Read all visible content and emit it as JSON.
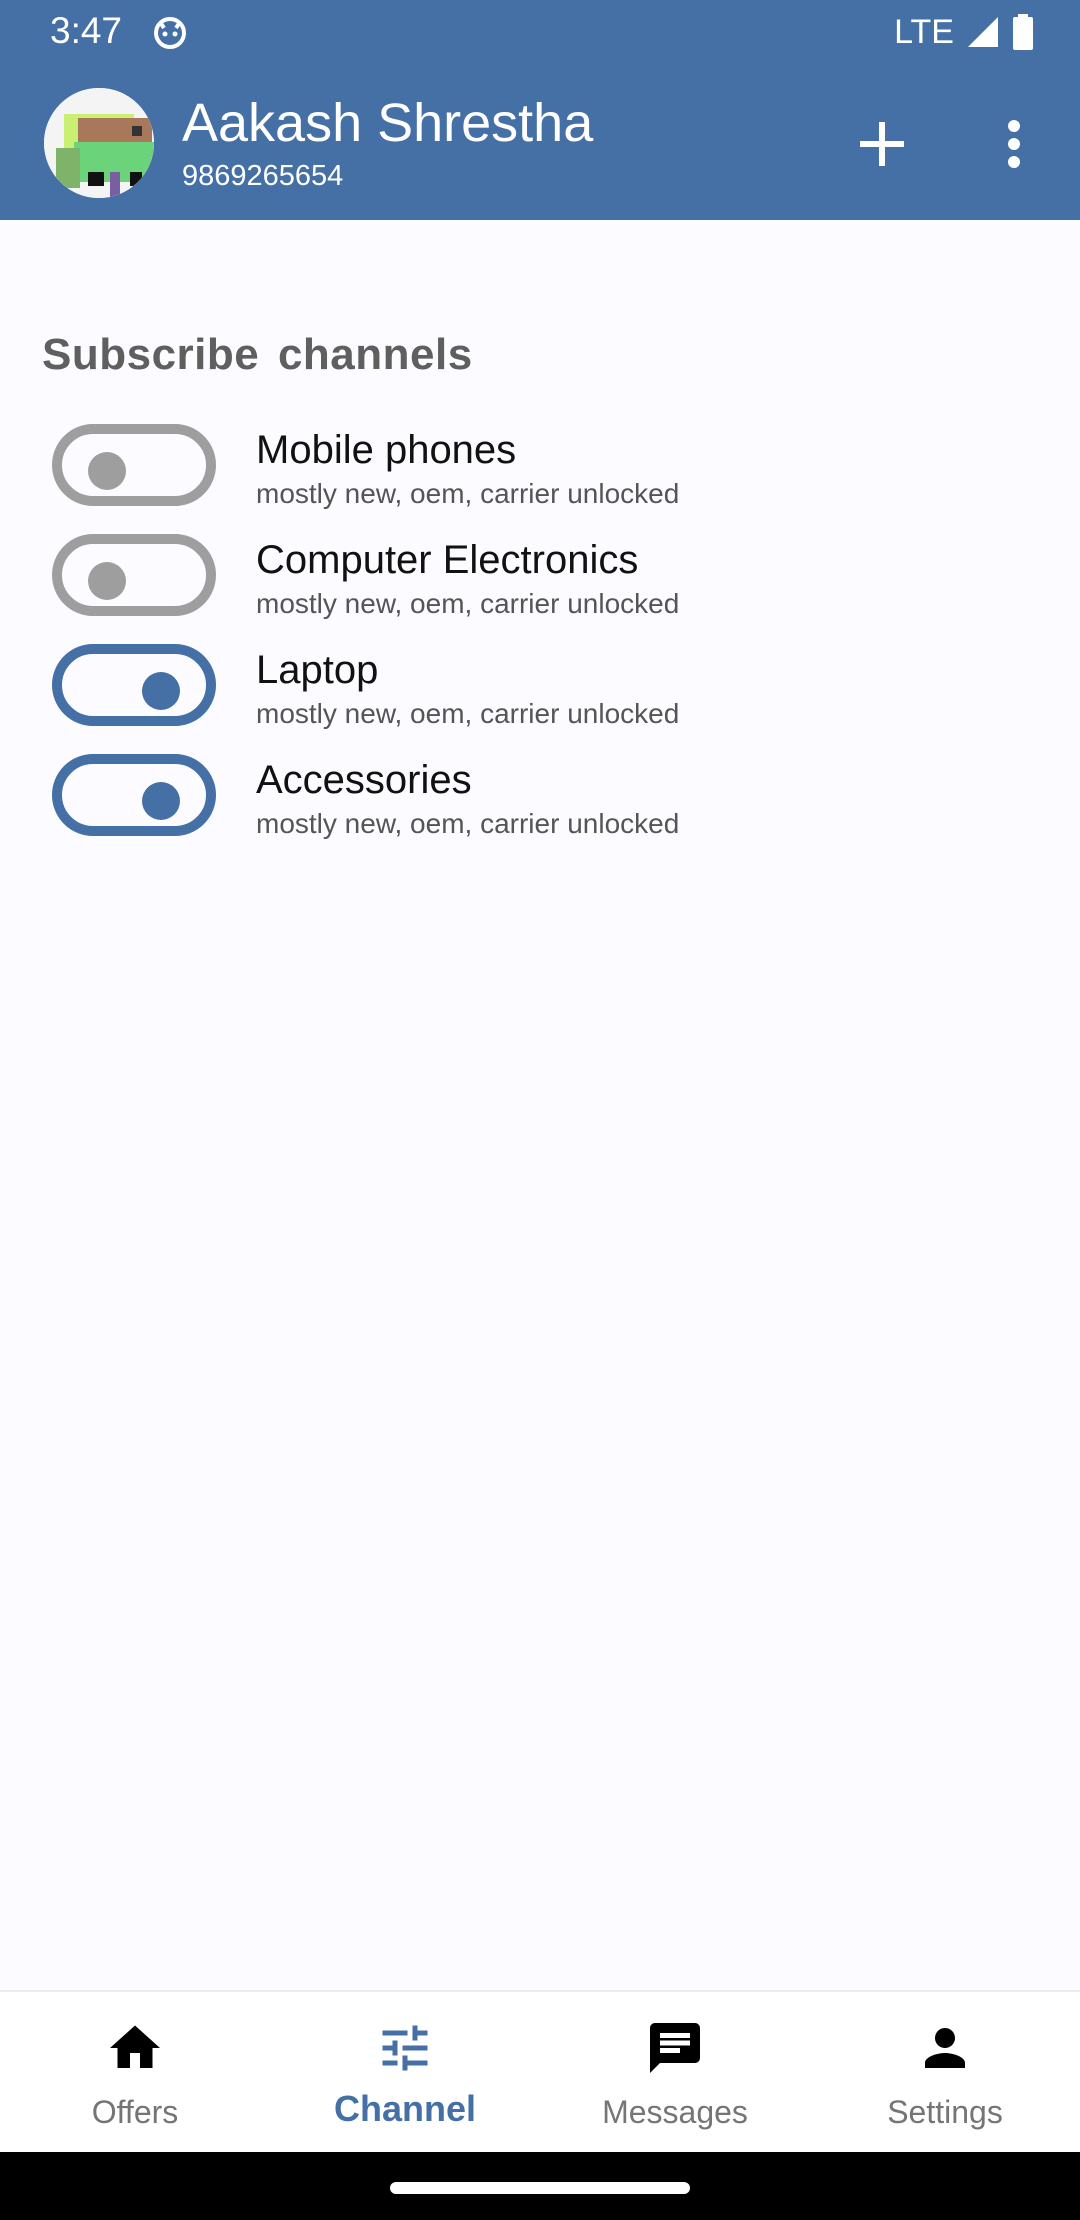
{
  "status_bar": {
    "time": "3:47",
    "network": "LTE"
  },
  "app_bar": {
    "user_name": "Aakash Shrestha",
    "user_phone": "9869265654"
  },
  "section": {
    "title": "Subscribe channels"
  },
  "channels": [
    {
      "title": "Mobile phones",
      "subtitle": "mostly new, oem, carrier unlocked",
      "enabled": false
    },
    {
      "title": "Computer Electronics",
      "subtitle": "mostly new, oem, carrier unlocked",
      "enabled": false
    },
    {
      "title": "Laptop",
      "subtitle": "mostly new, oem, carrier unlocked",
      "enabled": true
    },
    {
      "title": "Accessories",
      "subtitle": "mostly new, oem, carrier unlocked",
      "enabled": true
    }
  ],
  "bottom_nav": {
    "items": [
      {
        "label": "Offers",
        "icon": "home-icon"
      },
      {
        "label": "Channel",
        "icon": "tune-icon",
        "active": true
      },
      {
        "label": "Messages",
        "icon": "message-icon"
      },
      {
        "label": "Settings",
        "icon": "person-icon"
      }
    ]
  },
  "colors": {
    "primary": "#4570a5",
    "toggle_off": "#9e9e9e",
    "background": "#fcfbff"
  }
}
